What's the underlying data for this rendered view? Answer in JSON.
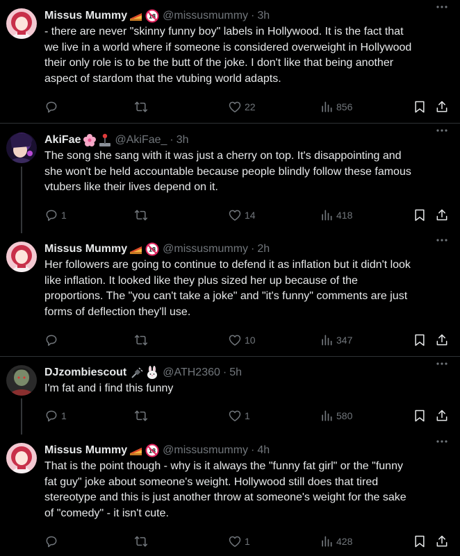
{
  "tweets": [
    {
      "name": "Missus Mummy",
      "handle": "@missusmummy",
      "time": "3h",
      "badges": [
        "pie-icon",
        "18-plus-icon"
      ],
      "lines": [
        "- there are never \"skinny funny boy\" labels in Hollywood. It is the fact that",
        "we live in a world where if someone is considered overweight in Hollywood",
        "their only role is to be the butt of the joke. I don't like that being another",
        "aspect of stardom that the vtubing world adapts."
      ],
      "replies": "",
      "retweets": "",
      "likes": "22",
      "views": "856"
    },
    {
      "name": "AkiFae",
      "handle": "@AkiFae_",
      "time": "3h",
      "badges": [
        "cherry-blossom-icon",
        "joystick-icon"
      ],
      "lines": [
        "The song she sang with it was just a cherry on top. It's disappointing and",
        "she won't be held accountable because people blindly follow these famous",
        "vtubers like their lives depend on it."
      ],
      "replies": "1",
      "retweets": "",
      "likes": "14",
      "views": "418"
    },
    {
      "name": "Missus Mummy",
      "handle": "@missusmummy",
      "time": "2h",
      "badges": [
        "pie-icon",
        "18-plus-icon"
      ],
      "lines": [
        "Her followers are going to continue to defend it as inflation but it didn't look",
        "like inflation. It looked like they plus sized her up because of the",
        "proportions. The \"you can't take a joke\" and \"it's funny\" comments are just",
        "forms of deflection they'll use."
      ],
      "replies": "",
      "retweets": "",
      "likes": "10",
      "views": "347"
    },
    {
      "name": "DJzombiescout",
      "handle": "@ATH2360",
      "time": "5h",
      "badges": [
        "plug-icon",
        "rabbit-icon"
      ],
      "lines": [
        "I'm fat and i find this funny"
      ],
      "replies": "1",
      "retweets": "",
      "likes": "1",
      "views": "580"
    },
    {
      "name": "Missus Mummy",
      "handle": "@missusmummy",
      "time": "4h",
      "badges": [
        "pie-icon",
        "18-plus-icon"
      ],
      "lines": [
        "That is the point though - why is it always the \"funny fat girl\" or the \"funny",
        "fat guy\" joke about someone's weight. Hollywood still does that tired",
        "stereotype and this is just another throw at someone's weight for the sake",
        "of \"comedy\" - it isn't cute."
      ],
      "replies": "",
      "retweets": "",
      "likes": "1",
      "views": "428"
    }
  ],
  "colors": {
    "background": "#000000",
    "text_primary": "#e7e9ea",
    "text_secondary": "#71767b",
    "separator": "#2f3336",
    "thread_line": "#333639"
  }
}
